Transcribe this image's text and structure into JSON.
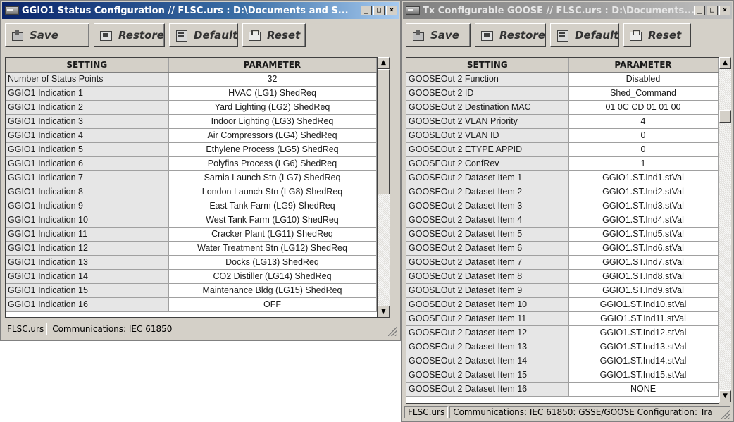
{
  "status_window": {
    "title": "GGIO1 Status Configuration // FLSC.urs : D:\\Documents and S...",
    "toolbar": {
      "save": "Save",
      "restore": "Restore",
      "default": "Default",
      "reset": "Reset"
    },
    "columns": {
      "setting": "SETTING",
      "parameter": "PARAMETER"
    },
    "rows": [
      {
        "setting": "Number of Status Points",
        "parameter": "32"
      },
      {
        "setting": "GGIO1 Indication 1",
        "parameter": "HVAC (LG1) ShedReq"
      },
      {
        "setting": "GGIO1 Indication 2",
        "parameter": "Yard Lighting (LG2) ShedReq"
      },
      {
        "setting": "GGIO1 Indication 3",
        "parameter": "Indoor Lighting (LG3) ShedReq"
      },
      {
        "setting": "GGIO1 Indication 4",
        "parameter": "Air Compressors (LG4) ShedReq"
      },
      {
        "setting": "GGIO1 Indication 5",
        "parameter": "Ethylene Process (LG5) ShedReq"
      },
      {
        "setting": "GGIO1 Indication 6",
        "parameter": "Polyfins Process (LG6) ShedReq"
      },
      {
        "setting": "GGIO1 Indication 7",
        "parameter": "Sarnia Launch Stn (LG7) ShedReq"
      },
      {
        "setting": "GGIO1 Indication 8",
        "parameter": "London Launch Stn (LG8) ShedReq"
      },
      {
        "setting": "GGIO1 Indication 9",
        "parameter": "East Tank Farm (LG9) ShedReq"
      },
      {
        "setting": "GGIO1 Indication 10",
        "parameter": "West Tank Farm (LG10) ShedReq"
      },
      {
        "setting": "GGIO1 Indication 11",
        "parameter": "Cracker Plant (LG11) ShedReq"
      },
      {
        "setting": "GGIO1 Indication 12",
        "parameter": "Water Treatment Stn (LG12) ShedReq"
      },
      {
        "setting": "GGIO1 Indication 13",
        "parameter": "Docks (LG13) ShedReq"
      },
      {
        "setting": "GGIO1 Indication 14",
        "parameter": "CO2 Distiller (LG14) ShedReq"
      },
      {
        "setting": "GGIO1 Indication 15",
        "parameter": "Maintenance Bldg (LG15) ShedReq"
      },
      {
        "setting": "GGIO1 Indication 16",
        "parameter": "OFF"
      }
    ],
    "status": {
      "file": "FLSC.urs",
      "path": "Communications: IEC 61850"
    }
  },
  "goose_window": {
    "title": "Tx Configurable GOOSE // FLSC.urs : D:\\Documents...",
    "toolbar": {
      "save": "Save",
      "restore": "Restore",
      "default": "Default",
      "reset": "Reset"
    },
    "columns": {
      "setting": "SETTING",
      "parameter": "PARAMETER"
    },
    "rows": [
      {
        "setting": "GOOSEOut 2 Function",
        "parameter": "Disabled"
      },
      {
        "setting": "GOOSEOut 2 ID",
        "parameter": "Shed_Command"
      },
      {
        "setting": "GOOSEOut 2 Destination MAC",
        "parameter": "01 0C CD 01 01 00"
      },
      {
        "setting": "GOOSEOut 2 VLAN Priority",
        "parameter": "4"
      },
      {
        "setting": "GOOSEOut 2 VLAN ID",
        "parameter": "0"
      },
      {
        "setting": "GOOSEOut 2 ETYPE APPID",
        "parameter": "0"
      },
      {
        "setting": "GOOSEOut 2 ConfRev",
        "parameter": "1"
      },
      {
        "setting": "GOOSEOut 2 Dataset Item 1",
        "parameter": "GGIO1.ST.Ind1.stVal"
      },
      {
        "setting": "GOOSEOut 2 Dataset Item 2",
        "parameter": "GGIO1.ST.Ind2.stVal"
      },
      {
        "setting": "GOOSEOut 2 Dataset Item 3",
        "parameter": "GGIO1.ST.Ind3.stVal"
      },
      {
        "setting": "GOOSEOut 2 Dataset Item 4",
        "parameter": "GGIO1.ST.Ind4.stVal"
      },
      {
        "setting": "GOOSEOut 2 Dataset Item 5",
        "parameter": "GGIO1.ST.Ind5.stVal"
      },
      {
        "setting": "GOOSEOut 2 Dataset Item 6",
        "parameter": "GGIO1.ST.Ind6.stVal"
      },
      {
        "setting": "GOOSEOut 2 Dataset Item 7",
        "parameter": "GGIO1.ST.Ind7.stVal"
      },
      {
        "setting": "GOOSEOut 2 Dataset Item 8",
        "parameter": "GGIO1.ST.Ind8.stVal"
      },
      {
        "setting": "GOOSEOut 2 Dataset Item 9",
        "parameter": "GGIO1.ST.Ind9.stVal"
      },
      {
        "setting": "GOOSEOut 2 Dataset Item 10",
        "parameter": "GGIO1.ST.Ind10.stVal"
      },
      {
        "setting": "GOOSEOut 2 Dataset Item 11",
        "parameter": "GGIO1.ST.Ind11.stVal"
      },
      {
        "setting": "GOOSEOut 2 Dataset Item 12",
        "parameter": "GGIO1.ST.Ind12.stVal"
      },
      {
        "setting": "GOOSEOut 2 Dataset Item 13",
        "parameter": "GGIO1.ST.Ind13.stVal"
      },
      {
        "setting": "GOOSEOut 2 Dataset Item 14",
        "parameter": "GGIO1.ST.Ind14.stVal"
      },
      {
        "setting": "GOOSEOut 2 Dataset Item 15",
        "parameter": "GGIO1.ST.Ind15.stVal"
      },
      {
        "setting": "GOOSEOut 2 Dataset Item 16",
        "parameter": "NONE"
      }
    ],
    "status": {
      "file": "FLSC.urs",
      "path": "Communications: IEC 61850: GSSE/GOOSE Configuration: Tra"
    }
  },
  "icons": {
    "app": "app-icon",
    "minimize": "minimize-icon",
    "maximize": "maximize-icon",
    "close": "close-icon",
    "save": "save-icon",
    "restore": "restore-icon",
    "default": "default-icon",
    "reset": "reset-icon",
    "scroll_up": "scroll-up-icon",
    "scroll_down": "scroll-down-icon",
    "resize": "resize-grip-icon"
  },
  "colors": {
    "active_title": "#0a246a",
    "inactive_title": "#808080",
    "window_face": "#d4d0c8",
    "setting_cell": "#e6e6e6",
    "parameter_cell": "#ffffff"
  }
}
